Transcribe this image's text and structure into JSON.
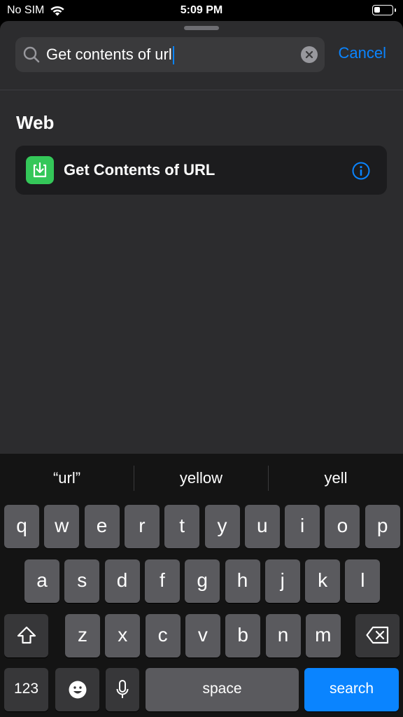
{
  "status": {
    "carrier": "No SIM",
    "time": "5:09 PM",
    "battery_level": 0.35
  },
  "search": {
    "value": "Get contents of url",
    "cancel_label": "Cancel"
  },
  "results": {
    "section_title": "Web",
    "items": [
      {
        "label": "Get Contents of URL",
        "icon": "download-icon",
        "icon_color": "#34c759"
      }
    ]
  },
  "keyboard": {
    "suggestions": [
      "“url”",
      "yellow",
      "yell"
    ],
    "row1": [
      "q",
      "w",
      "e",
      "r",
      "t",
      "y",
      "u",
      "i",
      "o",
      "p"
    ],
    "row2": [
      "a",
      "s",
      "d",
      "f",
      "g",
      "h",
      "j",
      "k",
      "l"
    ],
    "row3": [
      "z",
      "x",
      "c",
      "v",
      "b",
      "n",
      "m"
    ],
    "numbers_label": "123",
    "space_label": "space",
    "return_label": "search"
  },
  "colors": {
    "accent": "#0a84ff",
    "sheet_bg": "#2c2c2e",
    "row_bg": "#1c1c1e"
  }
}
